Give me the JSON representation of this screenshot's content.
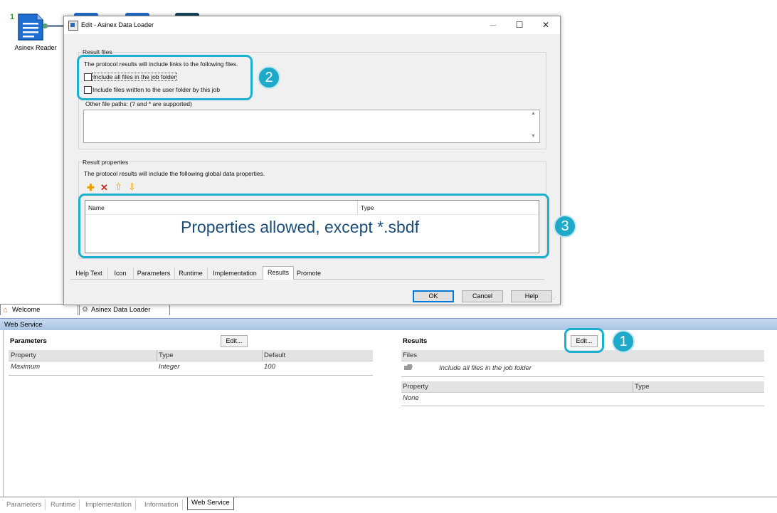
{
  "canvas": {
    "node_number": "1",
    "node_label": "Asinex Reader"
  },
  "dialog": {
    "title": "Edit - Asinex Data Loader",
    "window_controls": {
      "minimize": "─",
      "maximize": "☐",
      "close": "✕"
    },
    "result_files": {
      "title": "Result files",
      "description": "The protocol results will include links to the following files.",
      "checkbox_all_files": "Include all files in the job folder",
      "checkbox_user_folder": "Include files written to the user folder by this job",
      "other_paths_label": "Other file paths: (? and * are supported)",
      "other_paths_value": ""
    },
    "result_properties": {
      "title": "Result properties",
      "description": "The protocol results will include the following global data properties.",
      "toolbar_icons": [
        "add-icon",
        "delete-icon",
        "move-up-icon",
        "move-down-icon"
      ],
      "columns": [
        "Name",
        "Type"
      ]
    },
    "tabs": [
      "Help Text",
      "Icon",
      "Parameters",
      "Runtime",
      "Implementation",
      "Results",
      "Promote"
    ],
    "active_tab": "Results",
    "buttons": {
      "ok": "OK",
      "cancel": "Cancel",
      "help": "Help"
    }
  },
  "annotations": {
    "badge_1": "1",
    "badge_2": "2",
    "badge_3": "3",
    "note_3": "Properties allowed, except *.sbdf",
    "highlight_color": "#1bb1cd"
  },
  "document_tabs": {
    "welcome": "Welcome",
    "asinex": "Asinex Data Loader"
  },
  "web_service": {
    "header": "Web Service",
    "parameters": {
      "title": "Parameters",
      "edit_label": "Edit...",
      "columns": [
        "Property",
        "Type",
        "Default"
      ],
      "rows": [
        [
          "Maximum",
          "Integer",
          "100"
        ]
      ]
    },
    "results": {
      "title": "Results",
      "edit_label": "Edit...",
      "files_header": "Files",
      "file_rows": [
        "Include all files in the job folder"
      ],
      "columns": [
        "Property",
        "Type"
      ],
      "rows": [
        [
          "None"
        ]
      ]
    }
  },
  "bottom_tabs": [
    "Parameters",
    "Runtime",
    "Implementation",
    "Information",
    "Web Service"
  ],
  "bottom_active_tab": "Web Service"
}
